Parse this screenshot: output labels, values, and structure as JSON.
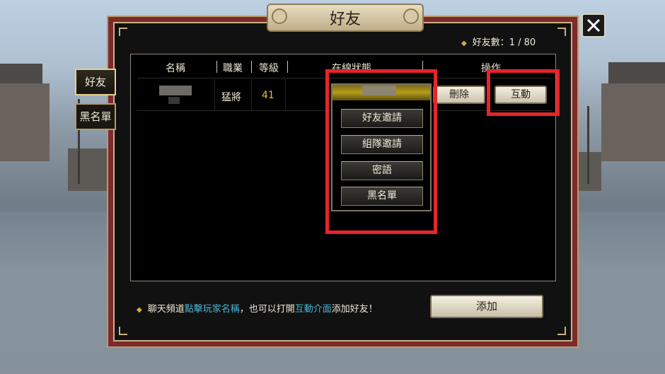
{
  "window": {
    "title": "好友"
  },
  "close_icon": "close-icon",
  "friend_count": {
    "label": "好友數：1 / 80"
  },
  "side_tabs": [
    {
      "label": "好友",
      "active": true
    },
    {
      "label": "黑名單",
      "active": false
    }
  ],
  "table": {
    "headers": {
      "name": "名稱",
      "class": "職業",
      "level": "等級",
      "status": "在線狀態",
      "action": "操作"
    },
    "rows": [
      {
        "class": "猛將",
        "level": "41",
        "delete_label": "刪除",
        "interact_label": "互動"
      }
    ]
  },
  "popup_menu": {
    "items": [
      "好友邀請",
      "組隊邀請",
      "密語",
      "黑名單"
    ]
  },
  "footer": {
    "hint_part1": "聊天頻道",
    "hint_link1": "點擊玩家名稱",
    "hint_part2": "，也可以打開",
    "hint_link2": "互動介面",
    "hint_part3": "添加好友！",
    "add_button": "添加"
  },
  "colors": {
    "highlight": "#e5252a",
    "level": "#f0c020",
    "hint_link": "#4ab8d8",
    "frame": "#7d2a2d"
  }
}
